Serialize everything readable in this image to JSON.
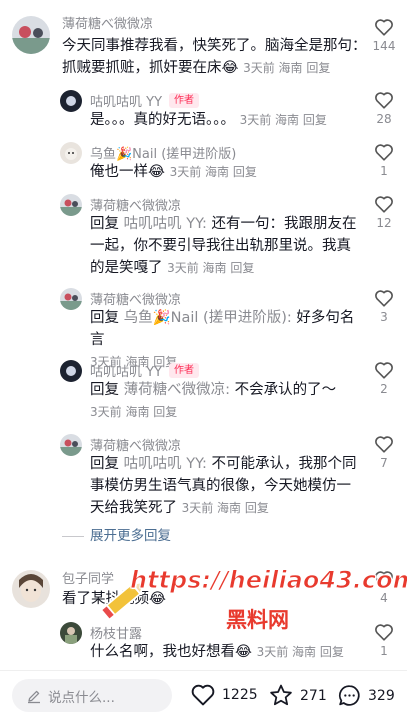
{
  "comments": [
    {
      "author": "薄荷糖べ微微凉",
      "text": "今天同事推荐我看，快笑死了。脑海全是那句：抓贼要抓赃，抓奸要在床",
      "emoji": "😂",
      "meta": "3天前 海南 回复",
      "likes": "144"
    },
    {
      "author": "咕叽咕叽 YY",
      "tag": "作者",
      "text": "是。。。真的好无语。。。",
      "meta": "3天前 海南 回复",
      "likes": "28"
    },
    {
      "author": "乌鱼🎉Nail (搓甲进阶版)",
      "text": "俺也一样",
      "emoji": "😂",
      "meta": "3天前 海南 回复",
      "likes": "1"
    },
    {
      "author": "薄荷糖べ微微凉",
      "reply_prefix": "回复",
      "reply_to": "咕叽咕叽 YY:",
      "text": "还有一句：我跟朋友在一起，你不要引导我往出轨那里说。我真的是笑嘎了",
      "meta": "3天前 海南 回复",
      "likes": "12"
    },
    {
      "author": "薄荷糖べ微微凉",
      "reply_prefix": "回复",
      "reply_to": "乌鱼🎉Nail (搓甲进阶版):",
      "text": "好多句名言",
      "meta": "3天前 海南 回复",
      "likes": "3"
    },
    {
      "author": "咕叽咕叽 YY",
      "tag": "作者",
      "reply_prefix": "回复",
      "reply_to": "薄荷糖べ微微凉:",
      "text": "不会承认的了～",
      "meta": "3天前 海南 回复",
      "likes": "2"
    },
    {
      "author": "薄荷糖べ微微凉",
      "reply_prefix": "回复",
      "reply_to": "咕叽咕叽 YY:",
      "text": "不可能承认，我那个同事模仿男生语气真的很像，今天她模仿一天给我笑死了",
      "meta": "3天前 海南 回复",
      "likes": "7"
    },
    {
      "author": "包子同学",
      "text": "看了某抖视频",
      "emoji": "😂",
      "likes": "4"
    },
    {
      "author": "杨枝甘露",
      "text": "什么名啊，我也好想看",
      "emoji": "😂",
      "meta": "3天前 海南 回复",
      "likes": "1"
    }
  ],
  "expand_label": "展开更多回复",
  "watermark": {
    "url": "https://heiliao43.com",
    "name": "黑料网"
  },
  "bottom_bar": {
    "placeholder": "说点什么...",
    "likes": "1225",
    "favorites": "271",
    "comments": "329"
  },
  "colors": {
    "author_tag": "#fe2c55",
    "link": "#4c6e92",
    "watermark": "#e83a2e"
  }
}
